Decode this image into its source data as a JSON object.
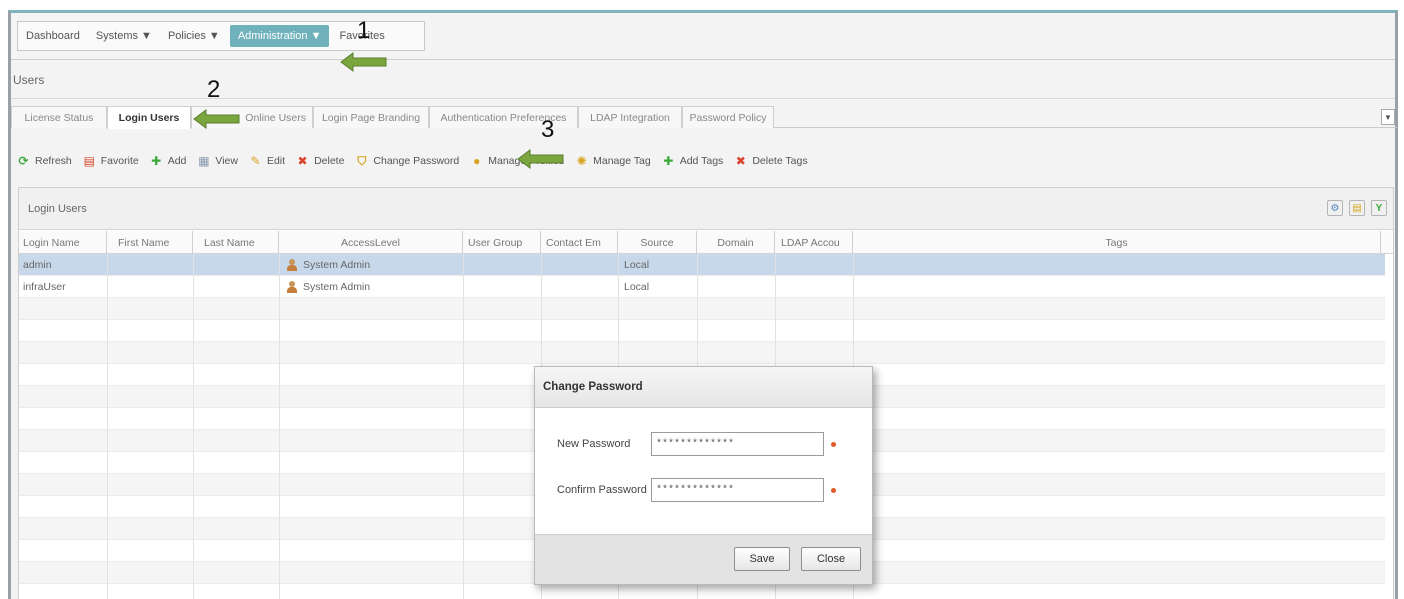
{
  "nav": {
    "items": [
      "Dashboard",
      "Systems ▼",
      "Policies ▼",
      "Administration ▼",
      "Favorites"
    ]
  },
  "page": {
    "title": "Users"
  },
  "tabs": [
    "License Status",
    "Login Users",
    "Online Users",
    "Login Page Branding",
    "Authentication Preferences",
    "LDAP Integration",
    "Password Policy"
  ],
  "toolbar": [
    "Refresh",
    "Favorite",
    "Add",
    "View",
    "Edit",
    "Delete",
    "Change Password",
    "Manage Profiles",
    "Manage Tag",
    "Add Tags",
    "Delete Tags"
  ],
  "grid": {
    "title": "Login Users",
    "columns": [
      "Login Name",
      "First Name",
      "Last Name",
      "AccessLevel",
      "User Group",
      "Contact Em",
      "Source",
      "Domain",
      "LDAP Accou",
      "Tags"
    ],
    "rows": [
      {
        "login": "admin",
        "access": "System Admin",
        "source": "Local"
      },
      {
        "login": "infraUser",
        "access": "System Admin",
        "source": "Local"
      }
    ]
  },
  "dialog": {
    "title": "Change Password",
    "new_label": "New Password",
    "new_value": "*************",
    "confirm_label": "Confirm Password",
    "confirm_value": "*************",
    "save": "Save",
    "close": "Close"
  },
  "annotations": {
    "step1": "1",
    "step2": "2",
    "step3": "3",
    "arrow_color": "#6f9a3c"
  },
  "colors": {
    "accent": "#6fb2bb",
    "selected_row": "#c7d8ea"
  }
}
